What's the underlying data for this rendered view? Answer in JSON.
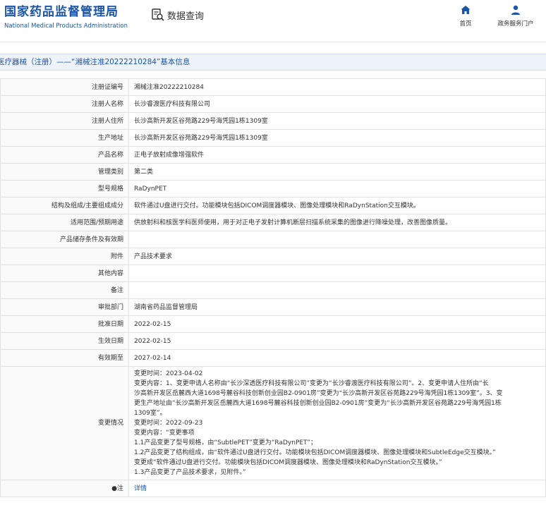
{
  "header": {
    "logo_cn": "国家药品监督管理局",
    "logo_en": "National Medical Products Administration",
    "query_label": "数据查询",
    "nav_home": "首页",
    "nav_portal": "政务服务门户",
    "brand_color": "#1a56a8"
  },
  "titlebar": {
    "text": "医疗器械（注册）——“湘械注准20222210284”基本信息"
  },
  "rows": [
    {
      "label": "注册证编号",
      "value": "湘械注准20222210284"
    },
    {
      "label": "注册人名称",
      "value": "长沙睿渡医疗科技有限公司"
    },
    {
      "label": "注册人住所",
      "value": "长沙高新开发区谷苑路229号海凭园1栋1309室"
    },
    {
      "label": "生产地址",
      "value": "长沙高新开发区谷苑路229号海凭园1栋1309室"
    },
    {
      "label": "产品名称",
      "value": "正电子放射成像增强软件"
    },
    {
      "label": "管理类别",
      "value": "第二类"
    },
    {
      "label": "型号规格",
      "value": "RaDynPET"
    },
    {
      "label": "结构及组成/主要组成成分",
      "value": "软件通过U盘进行交付。功能模块包括DICOM调度器模块、图像处理模块和RaDynStation交互模块。"
    },
    {
      "label": "适用范围/预期用途",
      "value": "供放射科和核医学科医师使用，用于对正电子发射计算机断层扫描系统采集的图像进行降噪处理，改善图像质量。"
    },
    {
      "label": "产品储存条件及有效期",
      "value": ""
    },
    {
      "label": "附件",
      "value": "产品技术要求"
    },
    {
      "label": "其他内容",
      "value": ""
    },
    {
      "label": "备注",
      "value": ""
    },
    {
      "label": "审批部门",
      "value": "湖南省药品监督管理局"
    },
    {
      "label": "批准日期",
      "value": "2022-02-15"
    },
    {
      "label": "生效日期",
      "value": "2022-02-15"
    },
    {
      "label": "有效期至",
      "value": "2027-02-14"
    }
  ],
  "changes": {
    "label": "变更情况",
    "lines": [
      "变更时间：2023-04-02",
      "变更内容：1、变更申请人名称由“长沙深透医疗科技有限公司”变更为“长沙睿渡医疗科技有限公司”。2、变更申请人住所由“长",
      "沙高新开发区岳麓西大道1698号麓谷科技创新创业园B2-0901房”变更为“长沙高新开发区谷苑路229号海凭园1栋1309室”。3、变",
      "更生产地址由“长沙高新开发区岳麓西大道1698号麓谷科技创新创业园B2-0901房”变更为“长沙高新开发区谷苑路229号海凭园1栋",
      "1309室”。",
      "变更时间：2022-09-23",
      "变更内容：“变更事项",
      "1.1产品变更了型号规格，由“SubtlePET”变更为“RaDynPET”；",
      "1.2产品变更了结构组成，由“软件通过U盘进行交付。功能模块包括DICOM调度器模块、图像处理模块和SubtleEdge交互模块。”",
      "变更成“软件通过U盘进行交付。功能模块包括DICOM调度器模块、图像处理模块和RaDynStation交互模块。”",
      "1.3产品变更了产品技术要求，见附件。”"
    ]
  },
  "note": {
    "label": "注",
    "link_text": "详情"
  }
}
